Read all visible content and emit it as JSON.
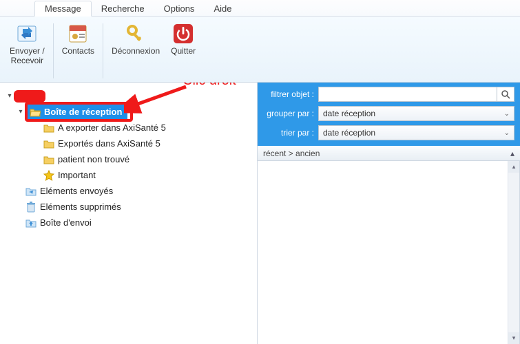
{
  "tabs": {
    "items": [
      {
        "label": "Message",
        "active": true
      },
      {
        "label": "Recherche",
        "active": false
      },
      {
        "label": "Options",
        "active": false
      },
      {
        "label": "Aide",
        "active": false
      }
    ]
  },
  "ribbon": {
    "send_receive": "Envoyer /\nRecevoir",
    "contacts": "Contacts",
    "disconnect": "Déconnexion",
    "quit": "Quitter"
  },
  "annotation": {
    "text": "Clic droit"
  },
  "tree": {
    "root_redacted": true,
    "inbox": "Boîte de réception",
    "inbox_children": [
      "A exporter dans AxiSanté 5",
      "Exportés dans AxiSanté 5",
      "patient non trouvé",
      "Important"
    ],
    "sent": "Eléments envoyés",
    "deleted": "Eléments supprimés",
    "outbox": "Boîte d'envoi"
  },
  "filters": {
    "filter_label": "filtrer objet :",
    "group_label": "grouper par :",
    "group_value": "date réception",
    "sort_label": "trier par :",
    "sort_value": "date réception",
    "search_placeholder": ""
  },
  "list": {
    "sort_header": "récent > ancien"
  }
}
